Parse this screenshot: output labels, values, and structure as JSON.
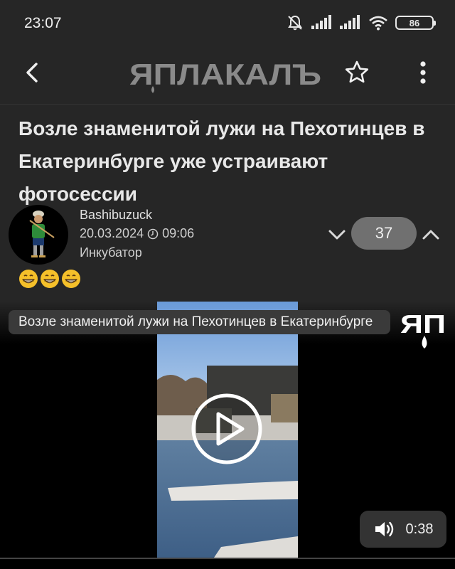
{
  "status_bar": {
    "time": "23:07",
    "battery": "86",
    "icons": [
      "mute-alarm-icon",
      "signal-icon",
      "signal-icon",
      "wifi-icon",
      "battery-icon"
    ]
  },
  "app_bar": {
    "logo_text": "ЯПЛАКАЛЪ",
    "icons": [
      "back-arrow-icon",
      "star-icon",
      "more-vert-icon"
    ]
  },
  "post": {
    "title": "Возле знаменитой лужи на Пехотинцев в Екатеринбурге  уже устраивают фотосессии",
    "author": "Bashibuzuck",
    "date": "20.03.2024",
    "time": "09:06",
    "section": "Инкубатор",
    "rating": "37",
    "emojis": [
      "grin-emoji",
      "grin-emoji",
      "grin-emoji"
    ]
  },
  "video": {
    "title": "Возле знаменитой лужи на Пехотинцев в Екатеринбурге",
    "logo_text": "ЯП",
    "duration": "0:38",
    "icons": [
      "play-icon",
      "volume-icon"
    ]
  }
}
